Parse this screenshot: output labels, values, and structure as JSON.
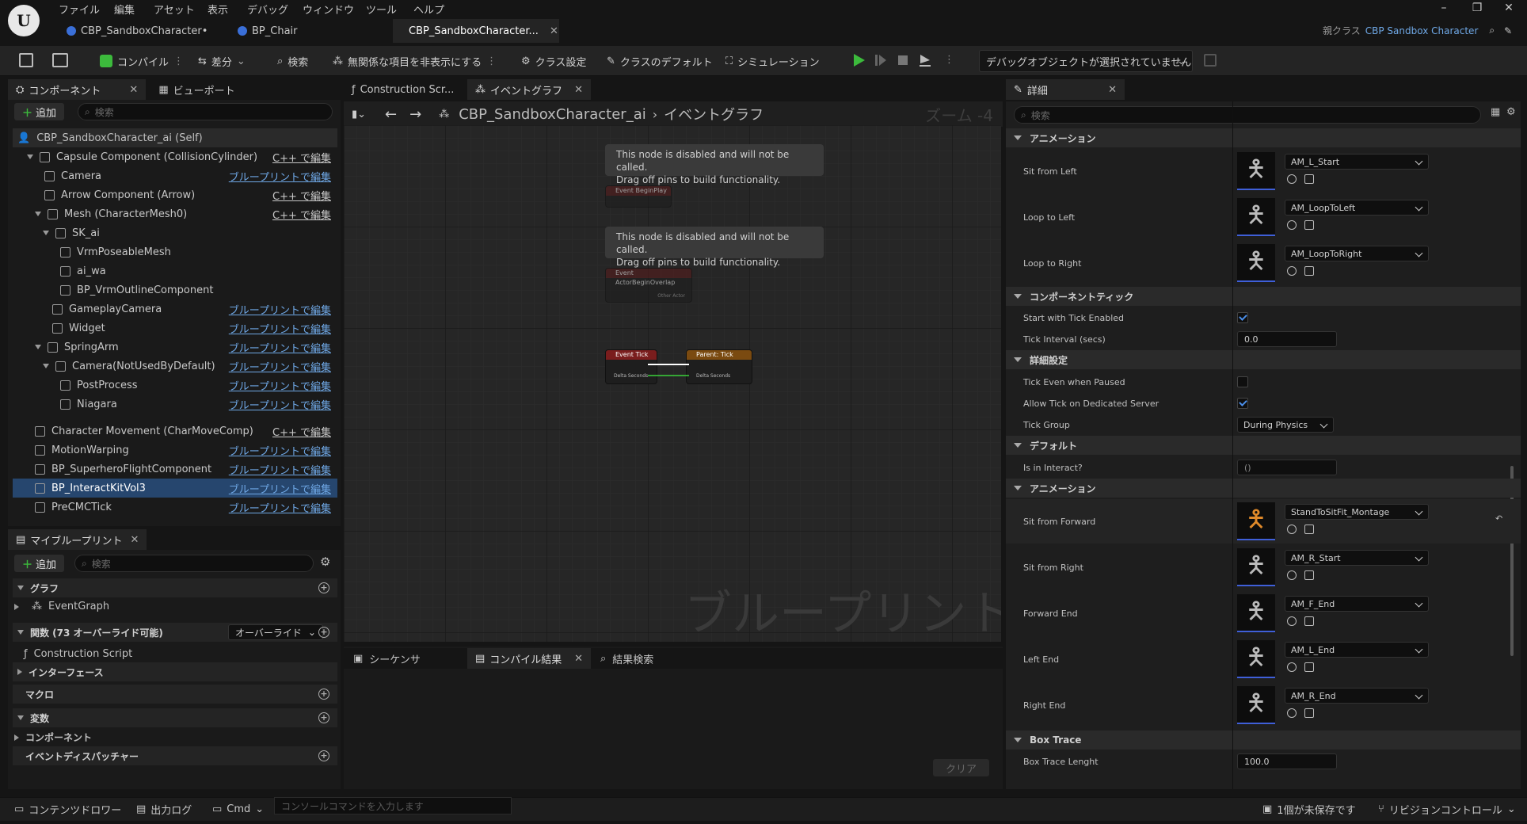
{
  "app": {
    "menu": [
      "ファイル",
      "編集",
      "アセット",
      "表示",
      "デバッグ",
      "ウィンドウ",
      "ツール",
      "ヘルプ"
    ],
    "tabs": [
      {
        "label": "CBP_SandboxCharacter•"
      },
      {
        "label": "BP_Chair"
      },
      {
        "label": "CBP_SandboxCharacter..."
      }
    ],
    "parent_class_label": "親クラス",
    "parent_class_value": "CBP Sandbox Character"
  },
  "toolbar": {
    "compile": "コンパイル",
    "diff": "差分",
    "search": "検索",
    "hide_unrelated": "無関係な項目を非表示にする",
    "class_settings": "クラス設定",
    "class_defaults": "クラスのデフォルト",
    "simulation": "シミュレーション",
    "debug_object": "デバッグオブジェクトが選択されていません"
  },
  "components": {
    "tab_label": "コンポーネント",
    "viewport_tab": "ビューポート",
    "add": "追加",
    "search_placeholder": "検索",
    "self_label": "CBP_SandboxCharacter_ai (Self)",
    "items": [
      {
        "label": "Capsule Component (CollisionCylinder)",
        "edit": "C++ で編集"
      },
      {
        "label": "Camera",
        "edit": "ブループリントで編集"
      },
      {
        "label": "Arrow Component (Arrow)",
        "edit": "C++ で編集"
      },
      {
        "label": "Mesh (CharacterMesh0)",
        "edit": "C++ で編集"
      },
      {
        "label": "SK_ai",
        "edit": ""
      },
      {
        "label": "VrmPoseableMesh",
        "edit": ""
      },
      {
        "label": "ai_wa",
        "edit": ""
      },
      {
        "label": "BP_VrmOutlineComponent",
        "edit": ""
      },
      {
        "label": "GameplayCamera",
        "edit": "ブループリントで編集"
      },
      {
        "label": "Widget",
        "edit": "ブループリントで編集"
      },
      {
        "label": "SpringArm",
        "edit": "ブループリントで編集"
      },
      {
        "label": "Camera(NotUsedByDefault)",
        "edit": "ブループリントで編集"
      },
      {
        "label": "PostProcess",
        "edit": "ブループリントで編集"
      },
      {
        "label": "Niagara",
        "edit": "ブループリントで編集"
      },
      {
        "label": "Character Movement (CharMoveComp)",
        "edit": "C++ で編集"
      },
      {
        "label": "MotionWarping",
        "edit": "ブループリントで編集"
      },
      {
        "label": "BP_SuperheroFlightComponent",
        "edit": "ブループリントで編集"
      },
      {
        "label": "BP_InteractKitVol3",
        "edit": "ブループリントで編集"
      },
      {
        "label": "PreCMCTick",
        "edit": "ブループリントで編集"
      }
    ]
  },
  "my_blueprint": {
    "tab_label": "マイブループリント",
    "add": "追加",
    "search_placeholder": "検索",
    "graph_section": "グラフ",
    "event_graph": "EventGraph",
    "functions_section": "関数 (73 オーバーライド可能)",
    "override": "オーバーライド",
    "construction_script": "Construction Script",
    "interface_section": "インターフェース",
    "macro_section": "マクロ",
    "variables_section": "変数",
    "components_section": "コンポーネント",
    "dispatchers_section": "イベントディスパッチャー"
  },
  "graph": {
    "tab_construction": "Construction Scr...",
    "tab_event": "イベントグラフ",
    "breadcrumb_root": "CBP_SandboxCharacter_ai",
    "breadcrumb_leaf": "イベントグラフ",
    "zoom": "ズーム -4",
    "watermark": "ブループリント",
    "disabled_note_line1": "This node is disabled and will not be called.",
    "disabled_note_line2": "Drag off pins to build functionality.",
    "node_begin_play": "Event BeginPlay",
    "node_begin_overlap": "Event ActorBeginOverlap",
    "node_other_actor": "Other Actor",
    "node_event_tick": "Event Tick",
    "node_parent_tick": "Parent: Tick",
    "delta_seconds": "Delta Seconds"
  },
  "bottom_tabs": {
    "sequencer": "シーケンサ",
    "compile_results": "コンパイル結果",
    "find_results": "結果検索",
    "clear": "クリア"
  },
  "details": {
    "tab_label": "詳細",
    "search_placeholder": "検索",
    "sections": {
      "animation": "アニメーション",
      "component_tick": "コンポーネントティック",
      "advanced": "詳細設定",
      "default": "デフォルト",
      "animation2": "アニメーション",
      "box_trace": "Box Trace"
    },
    "anim_rows_top": [
      {
        "name": "Sit from Left",
        "value": "AM_L_Start"
      },
      {
        "name": "Loop to Left",
        "value": "AM_LoopToLeft"
      },
      {
        "name": "Loop to Right",
        "value": "AM_LoopToRight"
      }
    ],
    "start_with_tick": {
      "name": "Start with Tick Enabled",
      "checked": true
    },
    "tick_interval": {
      "name": "Tick Interval (secs)",
      "value": "0.0"
    },
    "tick_even_paused": {
      "name": "Tick Even when Paused",
      "checked": false
    },
    "allow_tick_server": {
      "name": "Allow Tick on Dedicated Server",
      "checked": true
    },
    "tick_group": {
      "name": "Tick Group",
      "value": "During Physics"
    },
    "is_in_interact": {
      "name": "Is in Interact?",
      "value": "()"
    },
    "anim_rows_bottom": [
      {
        "name": "Sit from Forward",
        "value": "StandToSitFit_Montage"
      },
      {
        "name": "Sit from Right",
        "value": "AM_R_Start"
      },
      {
        "name": "Forward End",
        "value": "AM_F_End"
      },
      {
        "name": "Left End",
        "value": "AM_L_End"
      },
      {
        "name": "Right End",
        "value": "AM_R_End"
      }
    ],
    "box_trace_length": {
      "name": "Box Trace Lenght",
      "value": "100.0"
    }
  },
  "statusbar": {
    "content_drawer": "コンテンツドロワー",
    "output_log": "出力ログ",
    "cmd": "Cmd",
    "console_placeholder": "コンソールコマンドを入力します",
    "unsaved": "1個が未保存です",
    "revision_control": "リビジョンコントロール"
  },
  "colors": {
    "accent": "#3a6fd8",
    "selected_row": "#26466e",
    "link": "#6fa8e6",
    "play": "#3cba3c",
    "event_node": "#7a1d1d",
    "parent_node": "#7a4a10"
  }
}
